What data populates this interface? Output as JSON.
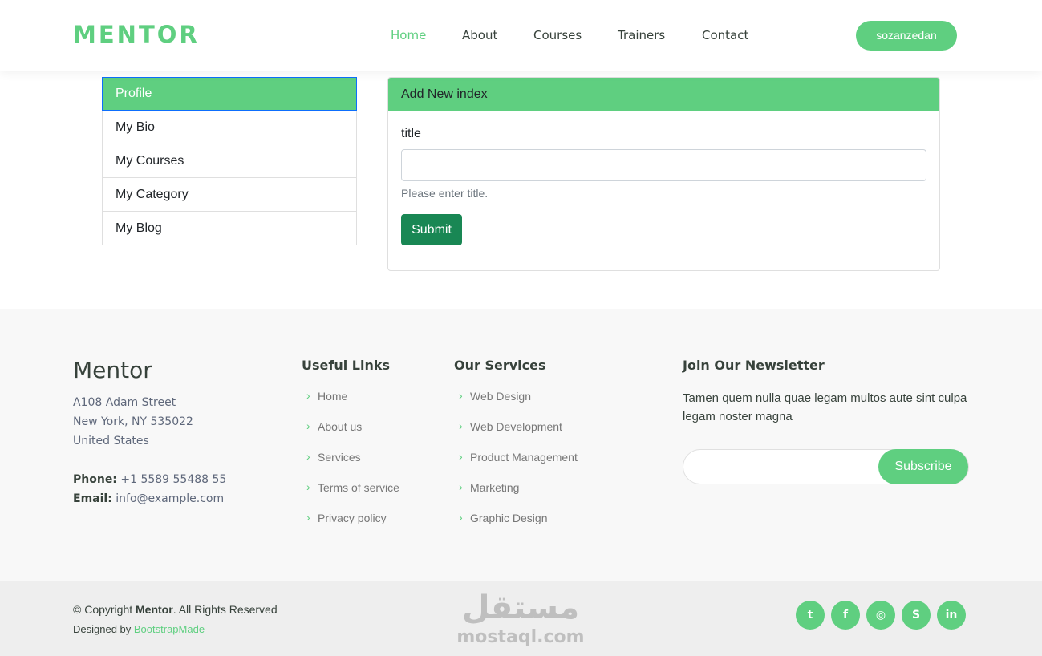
{
  "header": {
    "logo": "MENTOR",
    "nav": [
      "Home",
      "About",
      "Courses",
      "Trainers",
      "Contact"
    ],
    "active_nav": "Home",
    "user_button": "sozanzedan"
  },
  "sidebar": {
    "items": [
      {
        "label": "Profile",
        "active": true
      },
      {
        "label": "My Bio"
      },
      {
        "label": "My Courses"
      },
      {
        "label": "My Category"
      },
      {
        "label": "My Blog"
      }
    ]
  },
  "form": {
    "header": "Add New index",
    "field_label": "title",
    "field_value": "",
    "help_text": "Please enter title.",
    "submit_label": "Submit"
  },
  "footer": {
    "brand": "Mentor",
    "address": [
      "A108 Adam Street",
      "New York, NY 535022",
      "United States"
    ],
    "phone_label": "Phone:",
    "phone": "+1 5589 55488 55",
    "email_label": "Email:",
    "email": "info@example.com",
    "useful_links_title": "Useful Links",
    "useful_links": [
      "Home",
      "About us",
      "Services",
      "Terms of service",
      "Privacy policy"
    ],
    "services_title": "Our Services",
    "services": [
      "Web Design",
      "Web Development",
      "Product Management",
      "Marketing",
      "Graphic Design"
    ],
    "newsletter_title": "Join Our Newsletter",
    "newsletter_text": "Tamen quem nulla quae legam multos aute sint culpa legam noster magna",
    "newsletter_input": "",
    "subscribe_label": "Subscribe"
  },
  "bottom": {
    "copyright_prefix": "© Copyright ",
    "copyright_brand": "Mentor",
    "copyright_suffix": ". All Rights Reserved",
    "designed_by": "Designed by ",
    "designer": "BootstrapMade",
    "watermark_arabic": "مستقل",
    "watermark_latin": "mostaql.com",
    "social": [
      {
        "icon": "twitter-icon",
        "glyph": "t"
      },
      {
        "icon": "facebook-icon",
        "glyph": "f"
      },
      {
        "icon": "instagram-icon",
        "glyph": "◎"
      },
      {
        "icon": "skype-icon",
        "glyph": "S"
      },
      {
        "icon": "linkedin-icon",
        "glyph": "in"
      }
    ]
  },
  "colors": {
    "accent": "#5fcf80",
    "submit": "#198754",
    "text": "#37423b"
  }
}
